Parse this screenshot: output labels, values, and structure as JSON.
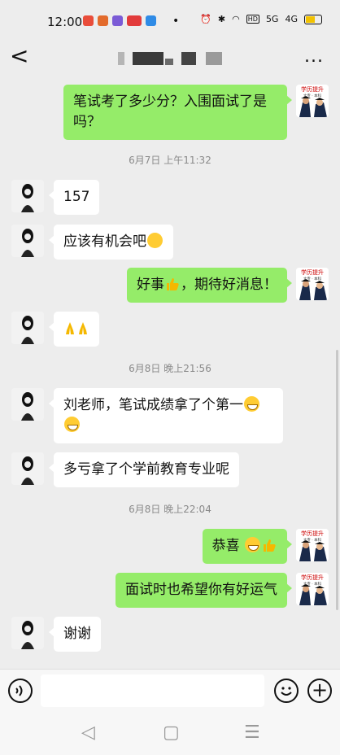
{
  "status_bar": {
    "time": "12:00",
    "network_a": "5G",
    "network_b": "4G"
  },
  "header": {
    "back_symbol": "<",
    "more_symbol": "..."
  },
  "messages": [
    {
      "from": "me",
      "text": "笔试考了多少分？入围面试了是吗？"
    },
    {
      "timestamp": "6月7日 上午11:32"
    },
    {
      "from": "other",
      "text": "157"
    },
    {
      "from": "other",
      "text": "应该有机会吧"
    },
    {
      "from": "me",
      "text": "好事，期待好消息！"
    },
    {
      "from": "other",
      "text": ""
    },
    {
      "timestamp": "6月8日 晚上21:56"
    },
    {
      "from": "other",
      "text": "刘老师，笔试成绩拿了个第一"
    },
    {
      "from": "other",
      "text": "多亏拿了个学前教育专业呢"
    },
    {
      "timestamp": "6月8日 晚上22:04"
    },
    {
      "from": "me",
      "text": "恭喜"
    },
    {
      "from": "me",
      "text": "面试时也希望你有好运气"
    },
    {
      "from": "other",
      "text": "谢谢"
    }
  ],
  "avatar_me": {
    "badge": "学历提升",
    "sub": "大专 · 本科"
  },
  "icons": [
    "back-icon",
    "more-icon",
    "voice-icon",
    "emoji-icon",
    "plus-icon",
    "nav-back-icon",
    "nav-home-icon",
    "nav-menu-icon"
  ],
  "colors": {
    "bubble_me": "#95ec69",
    "bubble_other": "#ffffff",
    "background": "#ededed"
  }
}
